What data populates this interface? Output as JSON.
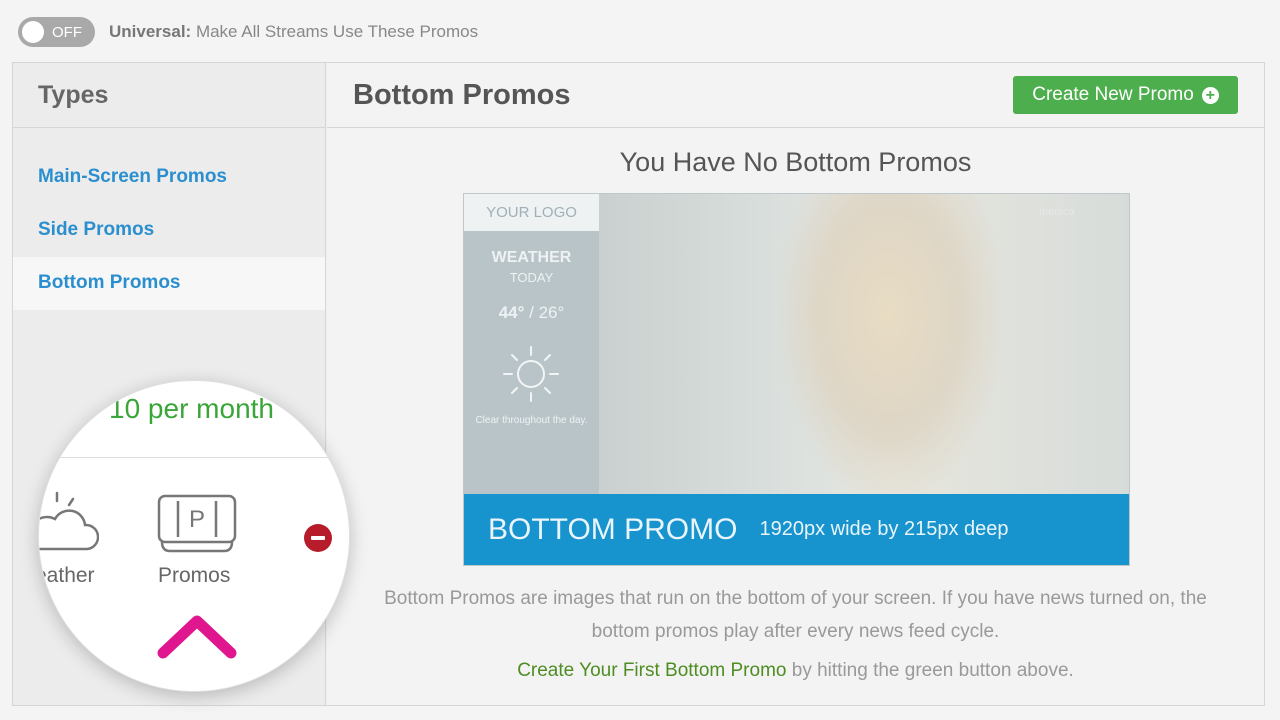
{
  "universal": {
    "toggle_state": "OFF",
    "label_bold": "Universal:",
    "label_text": "Make All Streams Use These Promos"
  },
  "sidebar": {
    "title": "Types",
    "items": [
      {
        "label": "Main-Screen Promos",
        "active": false
      },
      {
        "label": "Side Promos",
        "active": false
      },
      {
        "label": "Bottom Promos",
        "active": true
      }
    ]
  },
  "main": {
    "title": "Bottom Promos",
    "create_button": "Create New Promo",
    "empty_title": "You Have No Bottom Promos",
    "preview": {
      "logo": "YOUR LOGO",
      "weather_title": "WEATHER",
      "weather_day": "TODAY",
      "temp_high": "44°",
      "temp_low": "/ 26°",
      "forecast": "Clear throughout the day.",
      "watermark": "medica",
      "promo_big": "BOTTOM PROMO",
      "promo_small": "1920px wide by 215px deep"
    },
    "description": "Bottom Promos are images that run on the bottom of your screen. If you have news turned on, the bottom promos play after every news feed cycle.",
    "cta_link": "Create Your First Bottom Promo",
    "cta_rest": "by hitting the green button above."
  },
  "magnifier": {
    "price": "10 per month",
    "weather_label": "eather",
    "promos_label": "Promos",
    "promo_icon_letter": "P"
  },
  "colors": {
    "link_blue": "#2b8fcf",
    "button_green": "#4cae4c",
    "promo_blue": "#1793ce",
    "chevron_pink": "#e0168e",
    "remove_red": "#b71c2b"
  }
}
